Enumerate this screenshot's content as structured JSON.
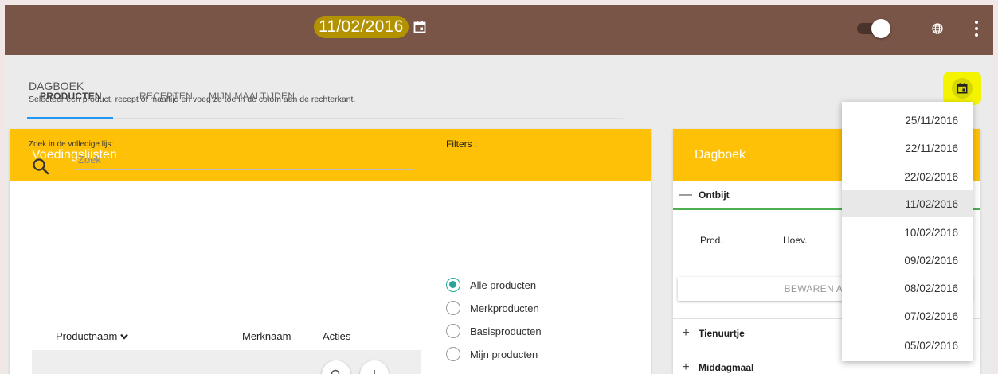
{
  "header": {
    "date": "11/02/2016"
  },
  "page": {
    "title": "DAGBOEK",
    "subtitle": "Selecteer een product, recept of maaltijd en voeg ze toe in de colom aan de rechterkant."
  },
  "left_card": {
    "title": "Voedingslijsten",
    "tabs": [
      {
        "label": "PRODUCTEN",
        "active": true
      },
      {
        "label": "RECEPTEN",
        "active": false
      },
      {
        "label": "MIJN MAALTIJDEN",
        "active": false
      }
    ],
    "search": {
      "label": "Zoek in de volledige lijst",
      "placeholder": "Zoek"
    },
    "filters": {
      "label": "Filters :",
      "options": [
        {
          "label": "Alle producten",
          "checked": true
        },
        {
          "label": "Merkproducten",
          "checked": false
        },
        {
          "label": "Basisproducten",
          "checked": false
        },
        {
          "label": "Mijn producten",
          "checked": false
        }
      ]
    },
    "table": {
      "columns": [
        "Productnaam",
        "Merknaam",
        "Acties"
      ]
    }
  },
  "right_card": {
    "title": "Dagboek",
    "sections": [
      "Ontbijt",
      "Tienuurtje",
      "Middagmaal"
    ],
    "columns": [
      "Prod.",
      "Hoev."
    ],
    "save_button": "BEWAREN ALS M"
  },
  "date_dropdown": {
    "items": [
      "25/11/2016",
      "22/11/2016",
      "22/02/2016",
      "11/02/2016",
      "10/02/2016",
      "09/02/2016",
      "08/02/2016",
      "07/02/2016",
      "05/02/2016"
    ],
    "selected": "11/02/2016"
  },
  "colors": {
    "topbar": "#795548",
    "card_header": "#ffc107",
    "tab_underline": "#2196f3",
    "radio_checked": "#26a69a",
    "section_line": "#4caf50",
    "highlight": "#f4f400"
  },
  "icons": [
    "calendar-icon",
    "toggle-switch",
    "globe-icon",
    "more-vert-icon",
    "search-icon",
    "chevron-down-icon",
    "add-icon",
    "remove-icon"
  ]
}
